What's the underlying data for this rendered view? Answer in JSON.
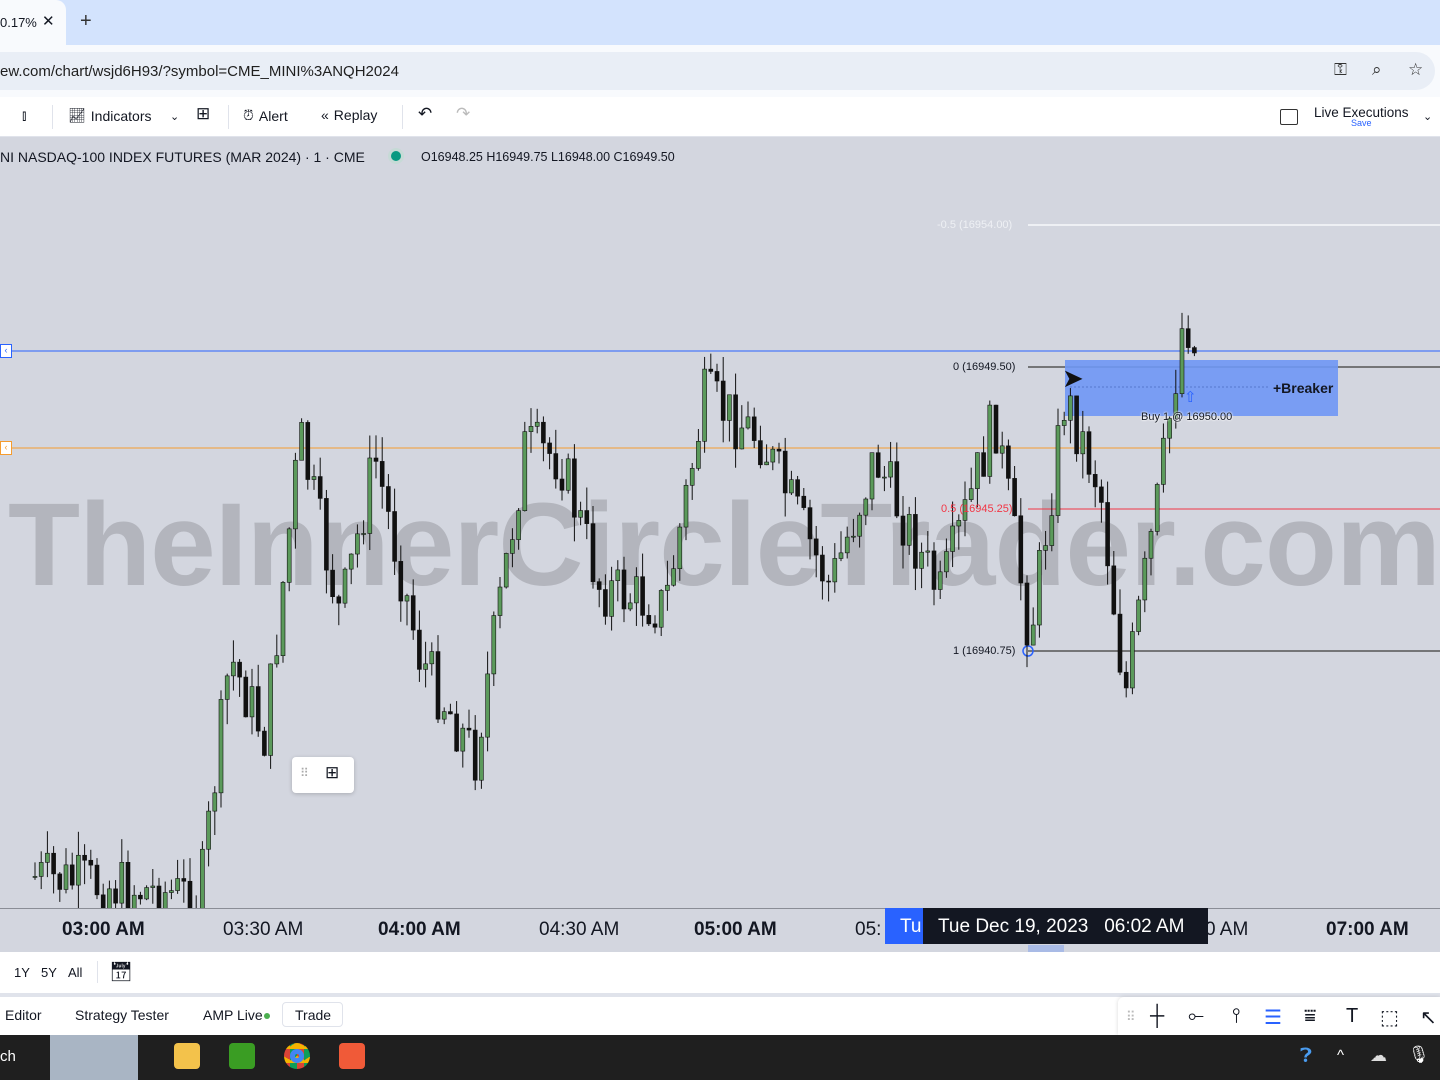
{
  "browser": {
    "tab_title": "0.17%",
    "close": "✕",
    "new_tab": "+",
    "url": "ew.com/chart/wsjd6H93/?symbol=CME_MINI%3ANQH2024"
  },
  "toolbar": {
    "indicators": "Indicators",
    "alert": "Alert",
    "replay": "Replay",
    "live_executions": "Live Executions",
    "save": "Save"
  },
  "legend": {
    "symbol": "NI NASDAQ-100 INDEX FUTURES (MAR 2024) · 1 · CME",
    "ohlc": "O16948.25 H16949.75 L16948.00 C16949.50",
    "status_color": "#089981"
  },
  "watermark": "TheInnerCircleTrader.com",
  "fib": {
    "m05": "-0.5 (16954.00)",
    "zero": "0 (16949.50)",
    "half": "0.5 (16945.25)",
    "one": "1 (16940.75)"
  },
  "breaker": {
    "label": "+Breaker",
    "color": "#6f97f5"
  },
  "execution": "Buy 1 @ 16950.00",
  "lines": {
    "blue": "#2962ff",
    "orange": "#f59c2f",
    "red": "#f23645"
  },
  "time_axis": [
    "03:00 AM",
    "03:30 AM",
    "04:00 AM",
    "04:30 AM",
    "05:00 AM",
    "05:",
    "Tu",
    "0 AM",
    "07:00 AM"
  ],
  "crosshair": {
    "date": "Tue Dec 19, 2023",
    "time": "06:02 AM"
  },
  "range": [
    "1Y",
    "5Y",
    "All"
  ],
  "panel": {
    "tabs": [
      "Editor",
      "Strategy Tester",
      "AMP Live"
    ],
    "trade": "Trade"
  },
  "taskbar": {
    "search": "ch"
  }
}
